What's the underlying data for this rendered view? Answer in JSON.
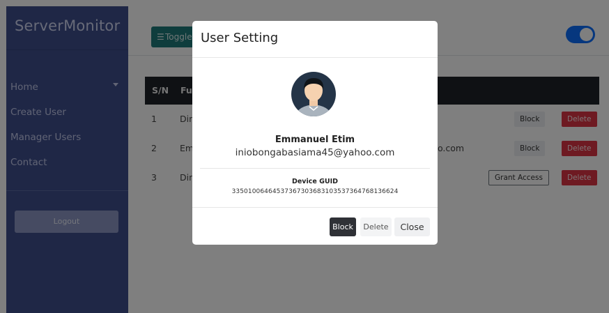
{
  "sidebar": {
    "brand": "ServerMonitor",
    "items": [
      {
        "label": "Home"
      },
      {
        "label": "Create User"
      },
      {
        "label": "Manager Users"
      },
      {
        "label": "Contact"
      }
    ],
    "logout_label": "Logout"
  },
  "topbar": {
    "toggle_label": "Toggle"
  },
  "table": {
    "headers": [
      "S/N",
      "Ful"
    ],
    "rows": [
      {
        "sn": "1",
        "name": "Din",
        "email": ""
      },
      {
        "sn": "2",
        "name": "Em",
        "email": "o.com"
      },
      {
        "sn": "3",
        "name": "Din",
        "email": ""
      }
    ],
    "actions": {
      "block": "Block",
      "delete": "Delete",
      "grant": "Grant Access"
    }
  },
  "modal": {
    "title": "User Setting",
    "user_name": "Emmanuel Etim",
    "user_email": "iniobongabasiama45@yahoo.com",
    "guid_label": "Device GUID",
    "guid_value": "33501006464537367303683103537364768136624",
    "block_label": "Block",
    "delete_label": "Delete",
    "close_label": "Close"
  },
  "colors": {
    "sidebar": "#3f4e8d",
    "toggle_button": "#1f7a7a",
    "switch": "#0d6efd",
    "delete": "#dc3545",
    "table_header": "#1e2329"
  }
}
